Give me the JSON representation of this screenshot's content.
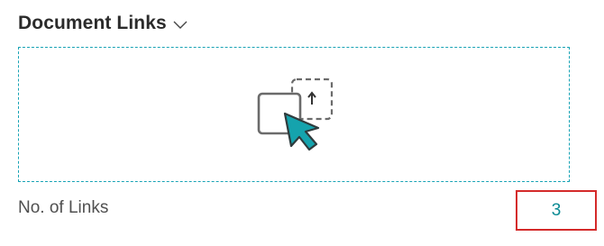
{
  "factbox": {
    "title": "Document Links",
    "toggle_icon": "chevron-down-icon"
  },
  "drop_zone": {
    "icon": "drag-drop-upload-icon",
    "accent_color": "#18a3b5"
  },
  "fields": {
    "no_of_links_label": "No. of Links",
    "no_of_links_value": "3"
  },
  "highlight": {
    "color": "#d42a2a"
  }
}
